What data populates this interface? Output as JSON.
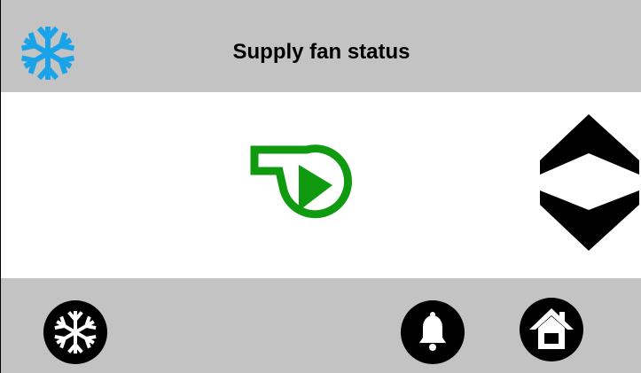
{
  "header": {
    "title": "Supply fan status",
    "mode_icon": "snowflake-icon",
    "mode_icon_color": "#1aa3e8"
  },
  "main": {
    "fan_icon": "supply-fan-icon",
    "fan_status_color": "#109a10",
    "scroll_up_icon": "chevron-up-icon",
    "scroll_down_icon": "chevron-down-icon"
  },
  "footer": {
    "buttons": [
      {
        "icon": "snowflake-icon"
      },
      {
        "icon": "bell-icon"
      },
      {
        "icon": "home-icon"
      }
    ]
  },
  "colors": {
    "bar_background": "#c3c3c3",
    "panel_background": "#ffffff",
    "icon_dark": "#000000"
  }
}
